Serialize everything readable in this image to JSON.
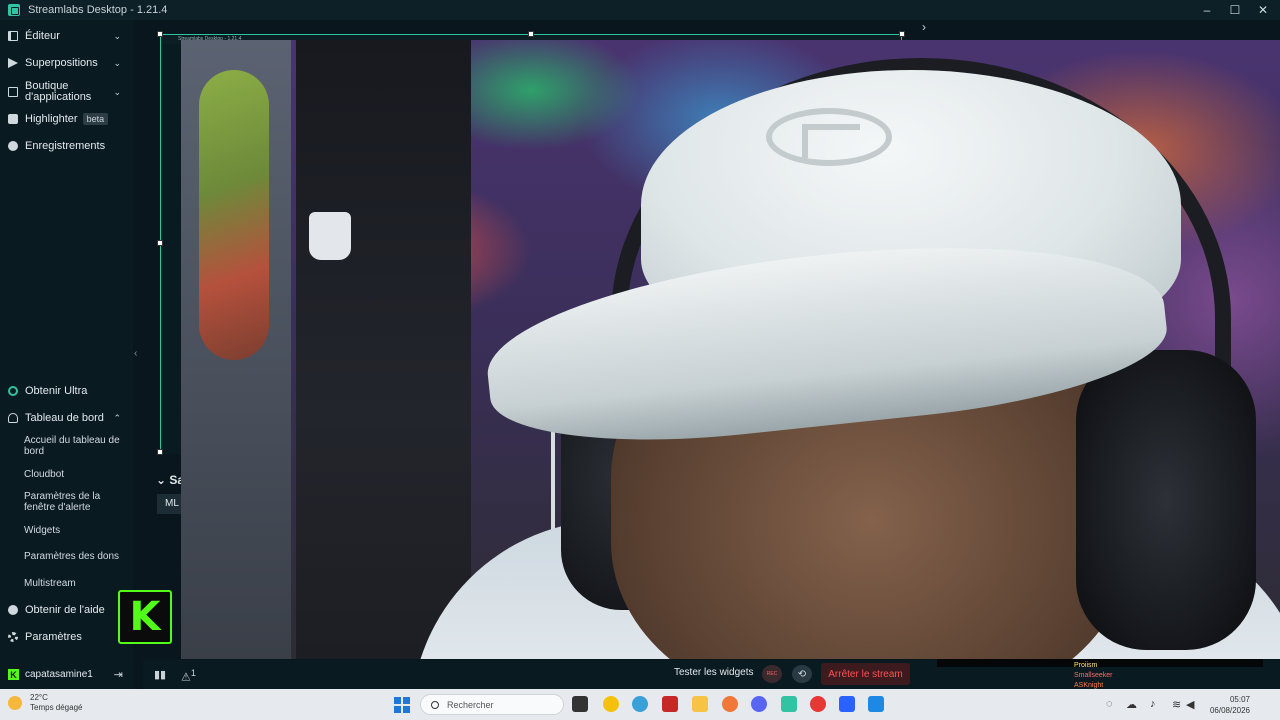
{
  "window": {
    "title": "Streamlabs Desktop - 1.21.4"
  },
  "sidebar": {
    "top_items": [
      {
        "label": "Éditeur"
      },
      {
        "label": "Superpositions"
      },
      {
        "label": "Boutique d'applications"
      },
      {
        "label": "Highlighter",
        "badge": "beta"
      },
      {
        "label": "Enregistrements"
      }
    ],
    "ultra": "Obtenir Ultra",
    "dashboard": "Tableau de bord",
    "dashboard_items": [
      "Accueil du tableau de bord",
      "Cloudbot",
      "Paramètres de la fenêtre d'alerte",
      "Widgets",
      "Paramètres des dons",
      "Multistream"
    ],
    "help": "Obtenir de l'aide",
    "settings": "Paramètres",
    "username": "capatasamine1"
  },
  "nested_preview": {
    "title": "Streamlabs Desktop - 1.21.4"
  },
  "scenes": {
    "label": "Sam",
    "chip": "ML"
  },
  "bottom_bar": {
    "test_widgets": "Tester les widgets",
    "rec_label": "REC",
    "stop_stream": "Arrêter le stream",
    "alert_count": "1"
  },
  "chat": [
    {
      "user": "Proiism",
      "color": "#ffe66b"
    },
    {
      "user": "Smallseeker",
      "color": "#ff6b6b"
    },
    {
      "user": "ASKnight",
      "color": "#ff7a4a"
    }
  ],
  "taskbar": {
    "temperature": "22°C",
    "weather": "Temps dégagé",
    "search_placeholder": "Rechercher",
    "time": "05:07",
    "date": "06/08/2026"
  },
  "colors": {
    "accent": "#31c3a2",
    "kick": "#53fc18",
    "danger": "#ff5252"
  }
}
